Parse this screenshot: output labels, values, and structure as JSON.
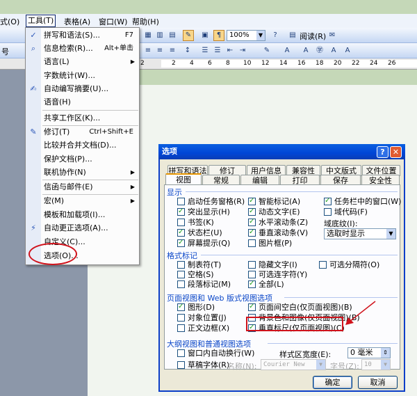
{
  "menubar": {
    "items": [
      "式(O)",
      "工具(T)",
      "表格(A)",
      "窗口(W)",
      "帮助(H)"
    ]
  },
  "toolbar": {
    "zoom": "100%",
    "read_label": "阅读(R)",
    "style_fragment": "号"
  },
  "ruler": {
    "marks": [
      "2",
      "2",
      "4",
      "6",
      "8",
      "10",
      "12",
      "14",
      "16",
      "18",
      "20",
      "22",
      "24",
      "26"
    ]
  },
  "tools_menu": {
    "items": [
      {
        "label": "拼写和语法(S)...",
        "shortcut": "F7",
        "icon": "abc-check-icon"
      },
      {
        "label": "信息检索(R)...",
        "shortcut": "Alt+单击",
        "icon": "research-icon"
      },
      {
        "label": "语言(L)",
        "submenu": true
      },
      {
        "label": "字数统计(W)..."
      },
      {
        "label": "自动编写摘要(U)...",
        "icon": "summary-icon"
      },
      {
        "label": "语音(H)"
      },
      {
        "label": "共享工作区(K)..."
      },
      {
        "label": "修订(T)",
        "shortcut": "Ctrl+Shift+E",
        "icon": "track-changes-icon"
      },
      {
        "label": "比较并合并文档(D)..."
      },
      {
        "label": "保护文档(P)..."
      },
      {
        "label": "联机协作(N)",
        "submenu": true
      },
      {
        "label": "信函与邮件(E)",
        "submenu": true
      },
      {
        "label": "宏(M)",
        "submenu": true
      },
      {
        "label": "模板和加载项(I)..."
      },
      {
        "label": "自动更正选项(A)...",
        "icon": "autocorrect-icon"
      },
      {
        "label": "自定义(C)..."
      },
      {
        "label": "选项(O)..."
      }
    ]
  },
  "dialog": {
    "title": "选项",
    "help": "?",
    "close": "✕",
    "tabs_row1": [
      "拼写和语法",
      "修订",
      "用户信息",
      "兼容性",
      "中文版式",
      "文件位置"
    ],
    "tabs_row2": [
      "视图",
      "常规",
      "编辑",
      "打印",
      "保存",
      "安全性"
    ],
    "sections": {
      "show": "显示",
      "format": "格式标记",
      "print_web": "页面视图和 Web 版式视图选项",
      "outline": "大纲视图和普通视图选项"
    },
    "show_options": [
      {
        "label": "启动任务窗格(R)",
        "checked": false
      },
      {
        "label": "智能标记(A)",
        "checked": true
      },
      {
        "label": "任务栏中的窗口(W)",
        "checked": true
      },
      {
        "label": "突出显示(H)",
        "checked": true
      },
      {
        "label": "动态文字(E)",
        "checked": true
      },
      {
        "label": "域代码(F)",
        "checked": false
      },
      {
        "label": "书签(K)",
        "checked": false
      },
      {
        "label": "水平滚动条(Z)",
        "checked": true
      },
      {
        "label": "状态栏(U)",
        "checked": true
      },
      {
        "label": "垂直滚动条(V)",
        "checked": true
      },
      {
        "label": "屏幕提示(Q)",
        "checked": true
      },
      {
        "label": "图片框(P)",
        "checked": false
      }
    ],
    "field_shading_label": "域底纹(I):",
    "field_shading_value": "选取时显示",
    "format_options": [
      {
        "label": "制表符(T)",
        "checked": false
      },
      {
        "label": "隐藏文字(I)",
        "checked": false
      },
      {
        "label": "可选分隔符(O)",
        "checked": false
      },
      {
        "label": "空格(S)",
        "checked": false
      },
      {
        "label": "可选连字符(Y)",
        "checked": false
      },
      {
        "label": "段落标记(M)",
        "checked": false
      },
      {
        "label": "全部(L)",
        "checked": true
      }
    ],
    "print_options": [
      {
        "label": "图形(D)",
        "checked": true
      },
      {
        "label": "页面间空白(仅页面视图)(B)",
        "checked": true
      },
      {
        "label": "对象位置(J)",
        "checked": false
      },
      {
        "label": "背景色和图像(仅页面视图)(B)",
        "checked": false
      },
      {
        "label": "正文边框(X)",
        "checked": false
      },
      {
        "label": "垂直标尺(仅页面视图)(C)",
        "checked": true
      }
    ],
    "outline": {
      "wrap_label": "窗口内自动换行(W)",
      "draft_label": "草稿字体(R)",
      "style_width_label": "样式区宽度(E):",
      "style_width_value": "0 毫米",
      "name_label": "名称(N):",
      "name_value": "Courier New",
      "size_label": "字号(Z):",
      "size_value": "10"
    },
    "ok": "确定",
    "cancel": "取消"
  }
}
